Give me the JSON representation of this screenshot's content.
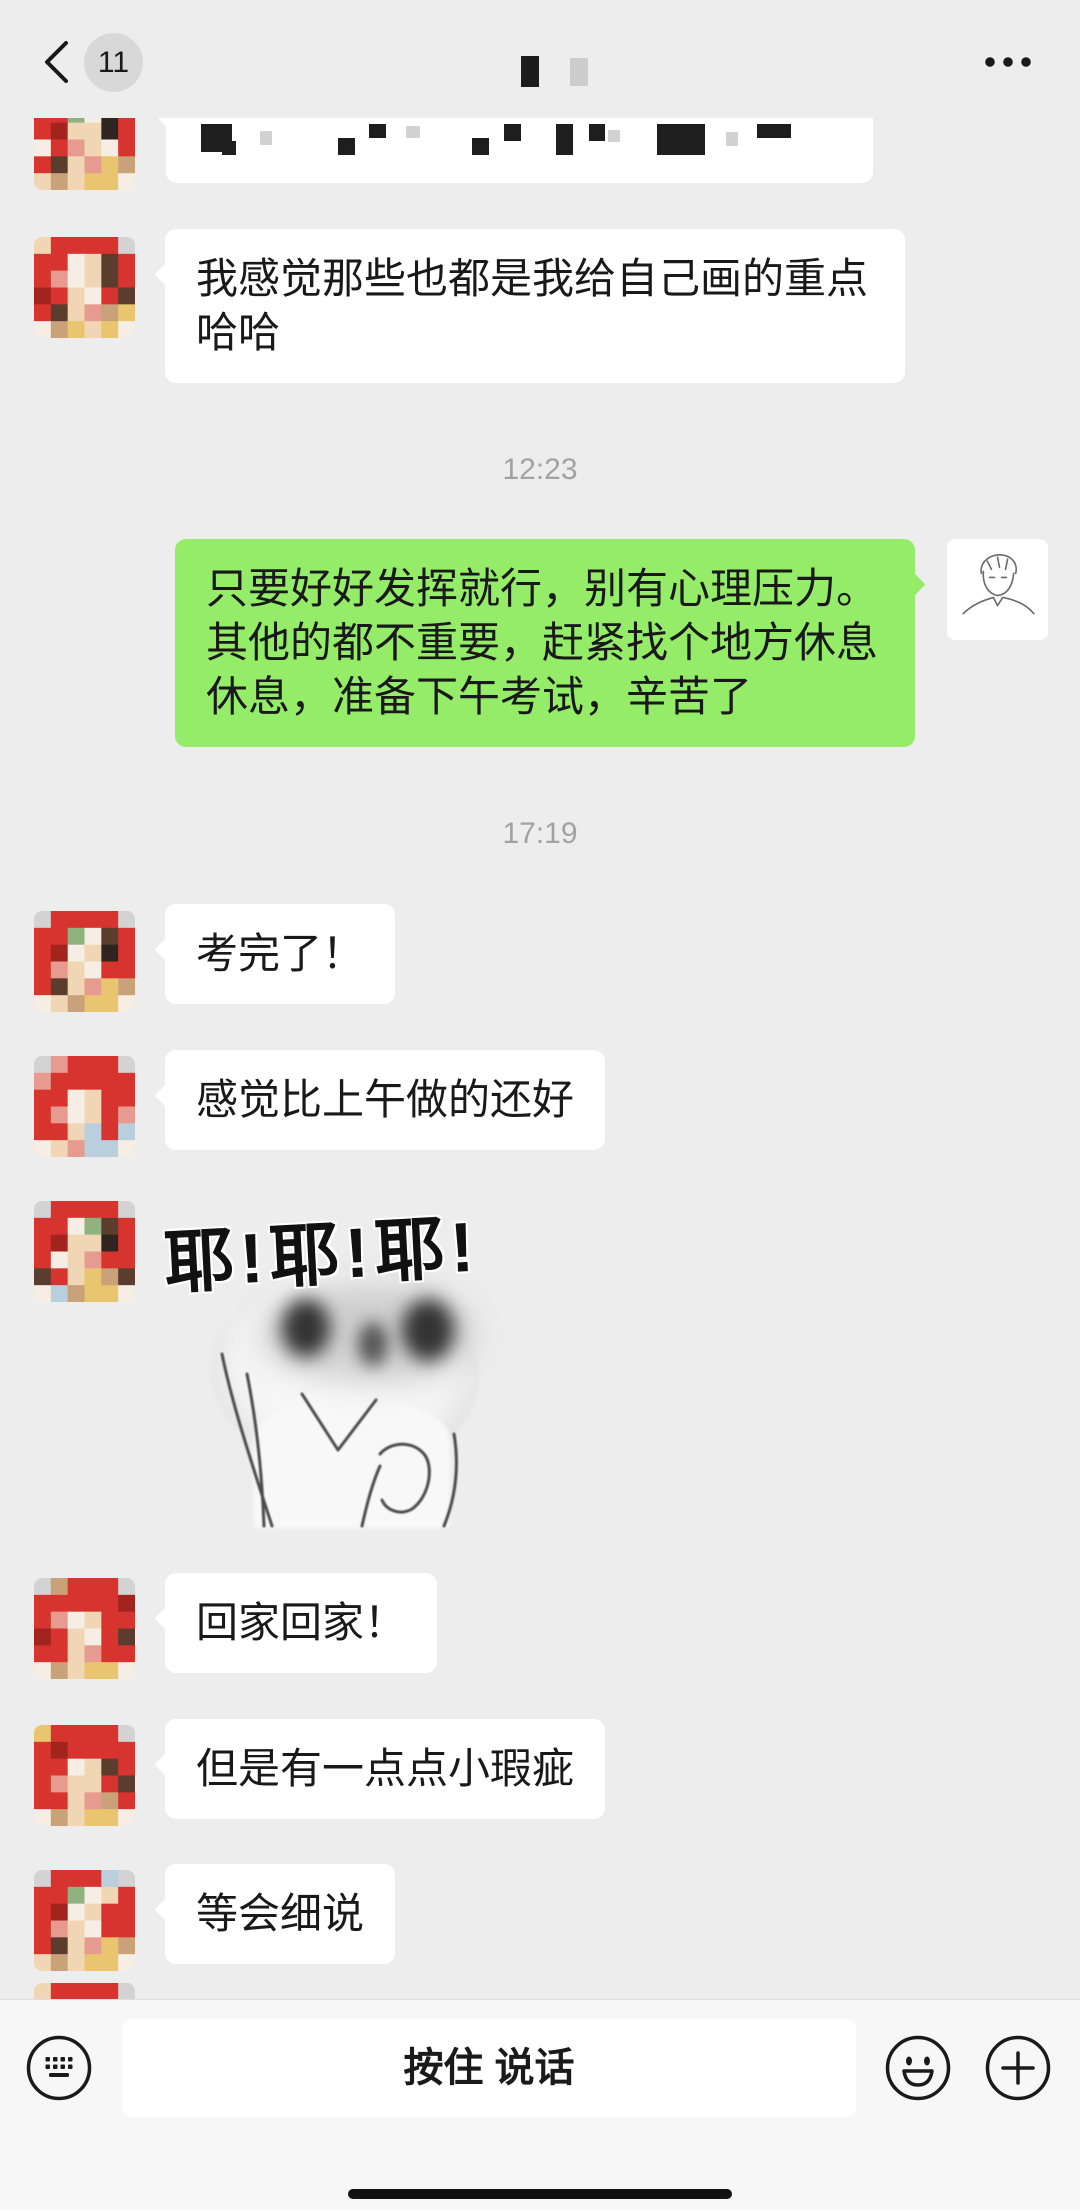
{
  "header": {
    "unread_count": "11",
    "back_icon": "chevron-left-icon",
    "more_icon": "more-horizontal-icon"
  },
  "messages": [
    {
      "text": "我感觉那些也都是我给自己画的重点哈哈"
    },
    {
      "time": "12:23"
    },
    {
      "text": "只要好好发挥就行，别有心理压力。其他的都不重要，赶紧找个地方休息休息，准备下午考试，辛苦了"
    },
    {
      "time": "17:19"
    },
    {
      "text": "考完了！"
    },
    {
      "text": "感觉比上午做的还好"
    },
    {
      "sticker_text": "耶!耶!耶!"
    },
    {
      "text": "回家回家！"
    },
    {
      "text": "但是有一点点小瑕疵"
    },
    {
      "text": "等会细说"
    }
  ],
  "input_bar": {
    "hold_to_talk_label": "按住 说话",
    "keyboard_icon": "keyboard-icon",
    "emoji_icon": "emoji-icon",
    "plus_icon": "plus-icon"
  },
  "colors": {
    "chat_background": "#ededed",
    "incoming_bubble": "#ffffff",
    "outgoing_bubble": "#95ec69",
    "timestamp_text": "#a2a2a2",
    "input_bar_background": "#f7f7f7"
  }
}
